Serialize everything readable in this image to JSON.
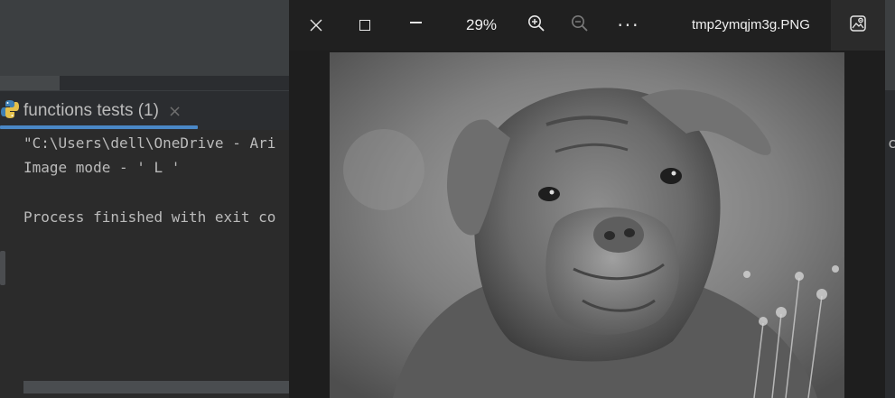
{
  "ide": {
    "run_tab_label": "functions tests (1)",
    "run_tab_close": "×",
    "console_lines": [
      "\"C:\\Users\\dell\\OneDrive - Ari",
      "Image mode - ' L '",
      "Process finished with exit co"
    ],
    "right_overflow_text": "c"
  },
  "viewer": {
    "zoom_level": "29%",
    "file_name": "tmp2ymqjm3g.PNG",
    "more_label": "···",
    "image_subject": "grayscale photo of a bulldog puppy"
  },
  "colors": {
    "ide_bg": "#2b2b2b",
    "tab_accent": "#4a88c7",
    "viewer_bg": "#202020"
  }
}
